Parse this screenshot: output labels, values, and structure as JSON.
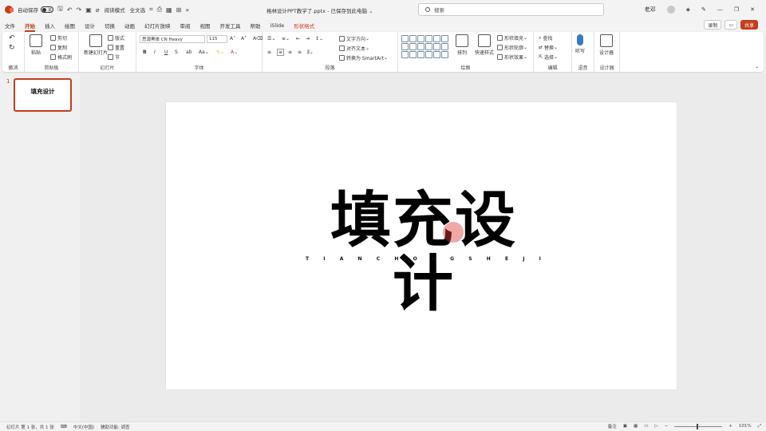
{
  "titlebar": {
    "autosave_label": "自动保存",
    "autosave_state": "关",
    "quick_access": [
      "阅读模式",
      "全文选"
    ],
    "doc_title": "格林设计PPT教学了.pptx - 已保存到此电脑 ⌄",
    "search_placeholder": "搜索",
    "user_name": "老邓"
  },
  "tabs": [
    {
      "label": "文件"
    },
    {
      "label": "开始",
      "active": true
    },
    {
      "label": "插入"
    },
    {
      "label": "绘图"
    },
    {
      "label": "设计"
    },
    {
      "label": "切换"
    },
    {
      "label": "动画"
    },
    {
      "label": "幻灯片放映"
    },
    {
      "label": "审阅"
    },
    {
      "label": "视图"
    },
    {
      "label": "开发工具"
    },
    {
      "label": "帮助"
    },
    {
      "label": "iSlide"
    },
    {
      "label": "形状格式",
      "context": true
    }
  ],
  "tab_right": {
    "record": "录制",
    "share": "共享"
  },
  "ribbon": {
    "undo_group": "撤消",
    "clipboard": {
      "label": "剪贴板",
      "paste": "粘贴",
      "cut": "剪切",
      "copy": "复制",
      "format_painter": "格式刷"
    },
    "slides": {
      "label": "幻灯片",
      "new_slide": "新建幻灯片",
      "layout": "版式",
      "reset": "重置",
      "section": "节"
    },
    "font": {
      "label": "字体",
      "font_name": "思源黑体 CN Heavy",
      "font_size": "115",
      "b": "B",
      "i": "I",
      "u": "U",
      "s": "S"
    },
    "paragraph": {
      "label": "段落",
      "text_direction": "文字方向",
      "align_text": "对齐文本",
      "smartart": "转换为 SmartArt"
    },
    "drawing": {
      "label": "绘图",
      "arrange": "排列",
      "quick_styles": "快速样式",
      "shape_fill": "形状填充",
      "shape_outline": "形状轮廓",
      "shape_effects": "形状效果"
    },
    "editing": {
      "label": "编辑",
      "find": "查找",
      "replace": "替换",
      "select": "选择"
    },
    "voice": {
      "label": "语音",
      "dictate": "听写"
    },
    "designer": {
      "label": "设计器",
      "designer_btn": "设计器"
    }
  },
  "thumbnail": {
    "number": "1",
    "title": "填充设计"
  },
  "slide": {
    "title": "填充设计",
    "subtitle_letters": [
      "T",
      "I",
      "A",
      "N",
      "C",
      "H",
      "O",
      "N",
      "G",
      "S",
      "H",
      "E",
      "J",
      "I"
    ]
  },
  "statusbar": {
    "slide_info": "幻灯片 第 1 张，共 1 张",
    "language": "中文(中国)",
    "accessibility": "辅助功能: 调查",
    "notes": "备注",
    "zoom": "101%"
  },
  "colors": {
    "accent": "#c43e1c",
    "ribbon_bg": "#ffffff",
    "chrome_bg": "#f3f3f3"
  }
}
